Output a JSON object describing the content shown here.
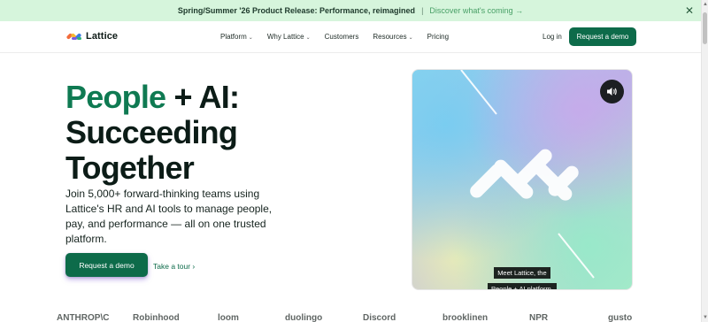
{
  "announcement": {
    "text": "Spring/Summer '26 Product Release: Performance, reimagined",
    "separator": "|",
    "link": "Discover what's coming →",
    "close": "✕"
  },
  "nav": {
    "brand": "Lattice",
    "menu": [
      {
        "label": "Platform",
        "dropdown": true
      },
      {
        "label": "Why Lattice",
        "dropdown": true
      },
      {
        "label": "Customers",
        "dropdown": false
      },
      {
        "label": "Resources",
        "dropdown": true
      },
      {
        "label": "Pricing",
        "dropdown": false
      }
    ],
    "login": "Log in",
    "cta": "Request a demo"
  },
  "hero": {
    "headline_accent": "People",
    "headline_rest1": " + AI:",
    "headline_line2": "Succeeding",
    "headline_line3": "Together",
    "description": "Join 5,000+ forward-thinking teams using Lattice's HR and AI tools to manage people, pay, and performance — all on one trusted platform.",
    "cta": "Request a demo",
    "tour": "Take a tour ›"
  },
  "video": {
    "caption_line1": "Meet Lattice, the",
    "caption_line2": "People + AI platform.",
    "sound_icon": "speaker-icon"
  },
  "customer_logos": [
    "ANTHROP\\C",
    "Robinhood",
    "loom",
    "duolingo",
    "Discord",
    "brooklinen",
    "NPR",
    "gusto"
  ],
  "colors": {
    "brand_green": "#0d6b4a",
    "accent_green": "#0f7a52",
    "announcement_bg": "#d6f5dc"
  }
}
